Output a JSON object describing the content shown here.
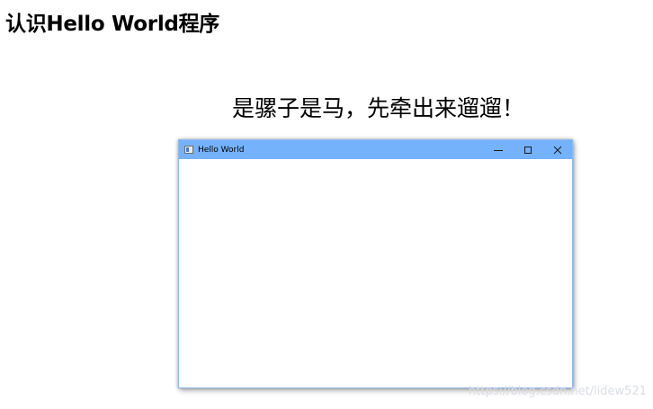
{
  "slide": {
    "title": "认识Hello World程序",
    "subtitle": "是骡子是马，先牵出来遛遛！"
  },
  "window": {
    "title": "Hello World",
    "icon": "app-window-icon",
    "titlebar_color": "#74b2fb",
    "controls": {
      "minimize_icon": "minimize-icon",
      "maximize_icon": "maximize-icon",
      "close_icon": "close-icon"
    }
  },
  "watermark": {
    "text": "https://blog.csdn.net/lidew521"
  }
}
